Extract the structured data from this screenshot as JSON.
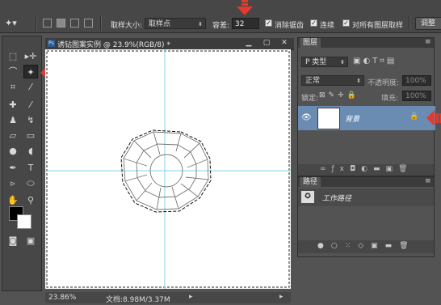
{
  "options": {
    "sample_size_label": "取样大小:",
    "sample_size_value": "取样点",
    "tolerance_label": "容差:",
    "tolerance_value": "32",
    "antialias_label": "消除锯齿",
    "contiguous_label": "连续",
    "all_layers_label": "对所有图层取样",
    "refine_button": "调整"
  },
  "document": {
    "tab_title": "诱钻图案实例 @ 23.9%(RGB/8) *",
    "zoom": "23.86%",
    "doc_size": "文档:8.98M/3.37M"
  },
  "layers_panel": {
    "tab": "图层",
    "filter_label": "P 类型",
    "blend_mode": "正常",
    "opacity_label": "不透明度:",
    "opacity_value": "100%",
    "lock_label": "锁定:",
    "fill_label": "填充:",
    "fill_value": "100%",
    "layer_name": "背景"
  },
  "paths_panel": {
    "tab": "路径",
    "path_name": "工作路径"
  },
  "colors": {
    "accent_arrow": "#e23a2e",
    "selected_layer": "#6a8cb3",
    "guide": "#7fd6e6"
  }
}
